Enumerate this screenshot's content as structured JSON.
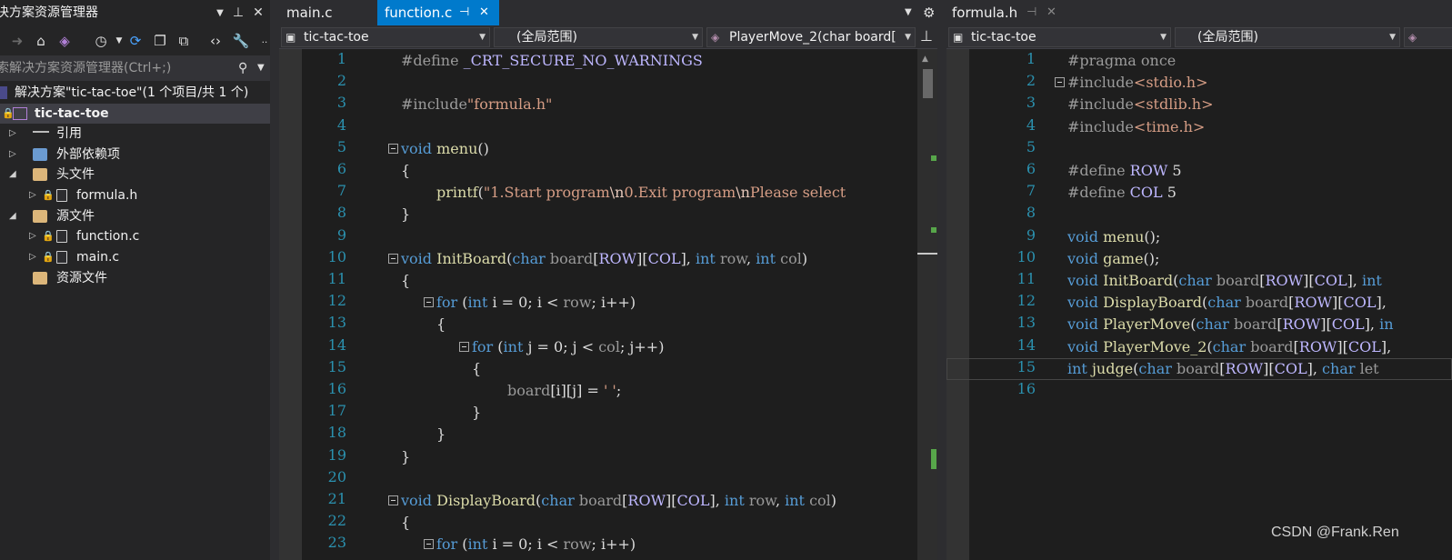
{
  "solution_explorer": {
    "title": "决方案资源管理器",
    "search_placeholder": "索解决方案资源管理器(Ctrl+;)",
    "solution_label": "解决方案\"tic-tac-toe\"(1 个项目/共 1 个)",
    "project_label": "tic-tac-toe",
    "items": [
      {
        "label": "引用"
      },
      {
        "label": "外部依赖项"
      },
      {
        "label": "头文件"
      },
      {
        "label": "formula.h"
      },
      {
        "label": "源文件"
      },
      {
        "label": "function.c"
      },
      {
        "label": "main.c"
      },
      {
        "label": "资源文件"
      }
    ]
  },
  "left_editor": {
    "tabs": [
      {
        "label": "main.c"
      },
      {
        "label": "function.c"
      }
    ],
    "nav": {
      "project": "tic-tac-toe",
      "scope": "(全局范围)",
      "member": "PlayerMove_2(char board["
    },
    "line_numbers": [
      "1",
      "2",
      "3",
      "4",
      "5",
      "6",
      "7",
      "8",
      "9",
      "10",
      "11",
      "12",
      "13",
      "14",
      "15",
      "16",
      "17",
      "18",
      "19",
      "20",
      "21",
      "22",
      "23"
    ]
  },
  "right_editor": {
    "tabs": [
      {
        "label": "formula.h"
      }
    ],
    "nav": {
      "project": "tic-tac-toe",
      "scope": "(全局范围)"
    },
    "line_numbers": [
      "1",
      "2",
      "3",
      "4",
      "5",
      "6",
      "7",
      "8",
      "9",
      "10",
      "11",
      "12",
      "13",
      "14",
      "15",
      "16"
    ]
  },
  "watermark": "CSDN @Frank.Ren",
  "colors": {
    "accent": "#007acc",
    "keyword": "#569cd6",
    "string": "#d69d85",
    "function": "#dcdcaa",
    "macro": "#beb7ff",
    "line_number": "#2b91af"
  }
}
